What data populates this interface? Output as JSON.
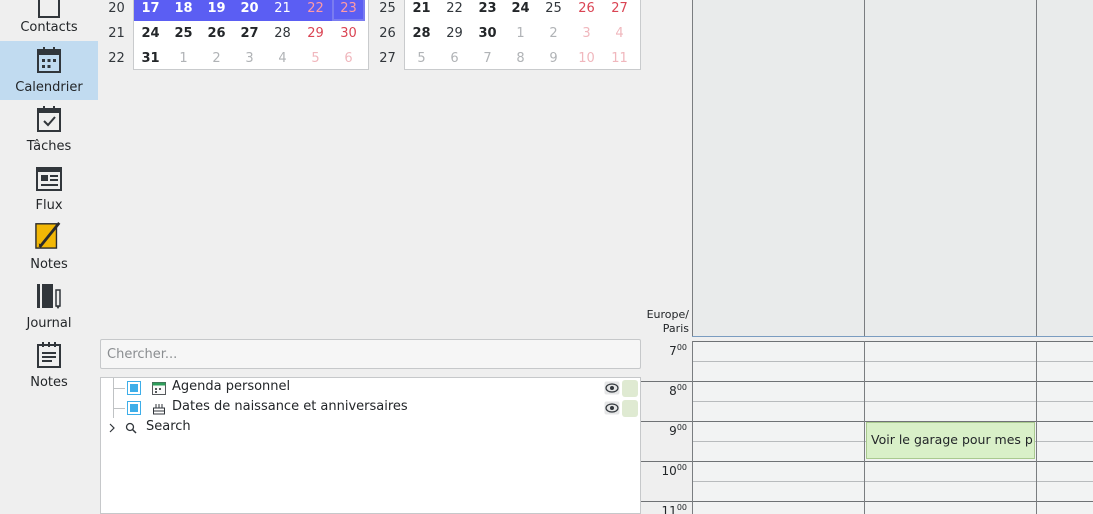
{
  "sidebar": {
    "items": [
      {
        "label": "Contacts",
        "icon": "contacts-icon"
      },
      {
        "label": "Calendrier",
        "icon": "calendar-icon",
        "active": true
      },
      {
        "label": "Tâches",
        "icon": "tasks-icon"
      },
      {
        "label": "Flux",
        "icon": "feed-icon"
      },
      {
        "label": "Notes",
        "icon": "notes-pencil-icon"
      },
      {
        "label": "Journal",
        "icon": "journal-icon"
      },
      {
        "label": "Notes",
        "icon": "notes-icon"
      }
    ]
  },
  "minical": {
    "left": {
      "weeks": [
        "20",
        "21",
        "22"
      ],
      "days": [
        [
          "17",
          "18",
          "19",
          "20",
          "21",
          "22",
          "23"
        ],
        [
          "24",
          "25",
          "26",
          "27",
          "28",
          "29",
          "30"
        ],
        [
          "31",
          "1",
          "2",
          "3",
          "4",
          "5",
          "6"
        ]
      ]
    },
    "right": {
      "weeks": [
        "25",
        "26",
        "27"
      ],
      "days": [
        [
          "21",
          "22",
          "23",
          "24",
          "25",
          "26",
          "27"
        ],
        [
          "28",
          "29",
          "30",
          "1",
          "2",
          "3",
          "4"
        ],
        [
          "5",
          "6",
          "7",
          "8",
          "9",
          "10",
          "11"
        ]
      ]
    }
  },
  "search": {
    "placeholder": "Chercher..."
  },
  "calendars": [
    {
      "label": "Agenda personnel",
      "icon": "agenda-icon"
    },
    {
      "label": "Dates de naissance et anniversaires",
      "icon": "birthday-cake-icon"
    },
    {
      "label": "Search",
      "icon": "search-icon"
    }
  ],
  "agenda": {
    "timezone_line1": "Europe/",
    "timezone_line2": "Paris",
    "hours": [
      "7",
      "8",
      "9",
      "10",
      "11"
    ],
    "hour_suffix": "00",
    "events": [
      {
        "title": "Voir le garage pour mes p"
      }
    ]
  },
  "colors": {
    "selection": "#5b5ef3",
    "weekend": "#da4453",
    "accent": "#3daee9",
    "event_bg": "#d9f0c8"
  }
}
